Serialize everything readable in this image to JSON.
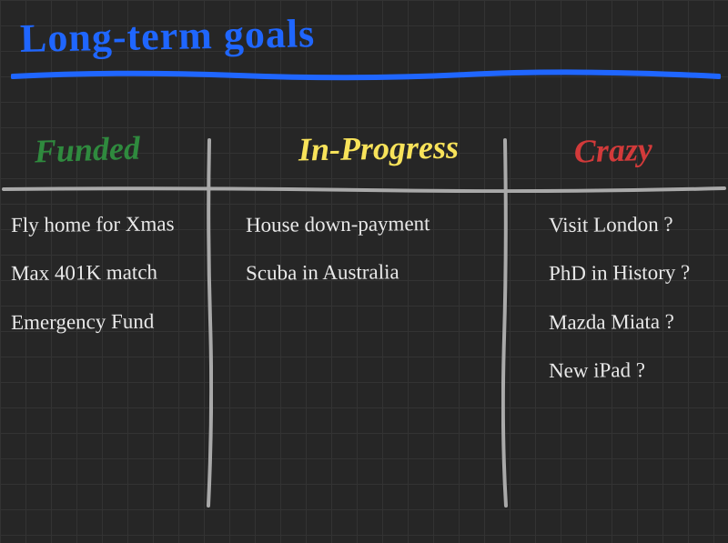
{
  "title": "Long-term goals",
  "columns": {
    "funded": {
      "header": "Funded",
      "items": [
        "Fly home for Xmas",
        "Max 401K match",
        "Emergency Fund"
      ]
    },
    "inprogress": {
      "header": "In-Progress",
      "items": [
        "House down-payment",
        "Scuba in Australia"
      ]
    },
    "crazy": {
      "header": "Crazy",
      "items": [
        "Visit London ?",
        "PhD in History ?",
        "Mazda Miata ?",
        "New iPad ?"
      ]
    }
  },
  "colors": {
    "title": "#1f66ff",
    "funded": "#2f8a3e",
    "inprogress": "#f8e35a",
    "crazy": "#d23a3a",
    "ink": "#e8e8e8",
    "divider": "#a9a9a9"
  }
}
